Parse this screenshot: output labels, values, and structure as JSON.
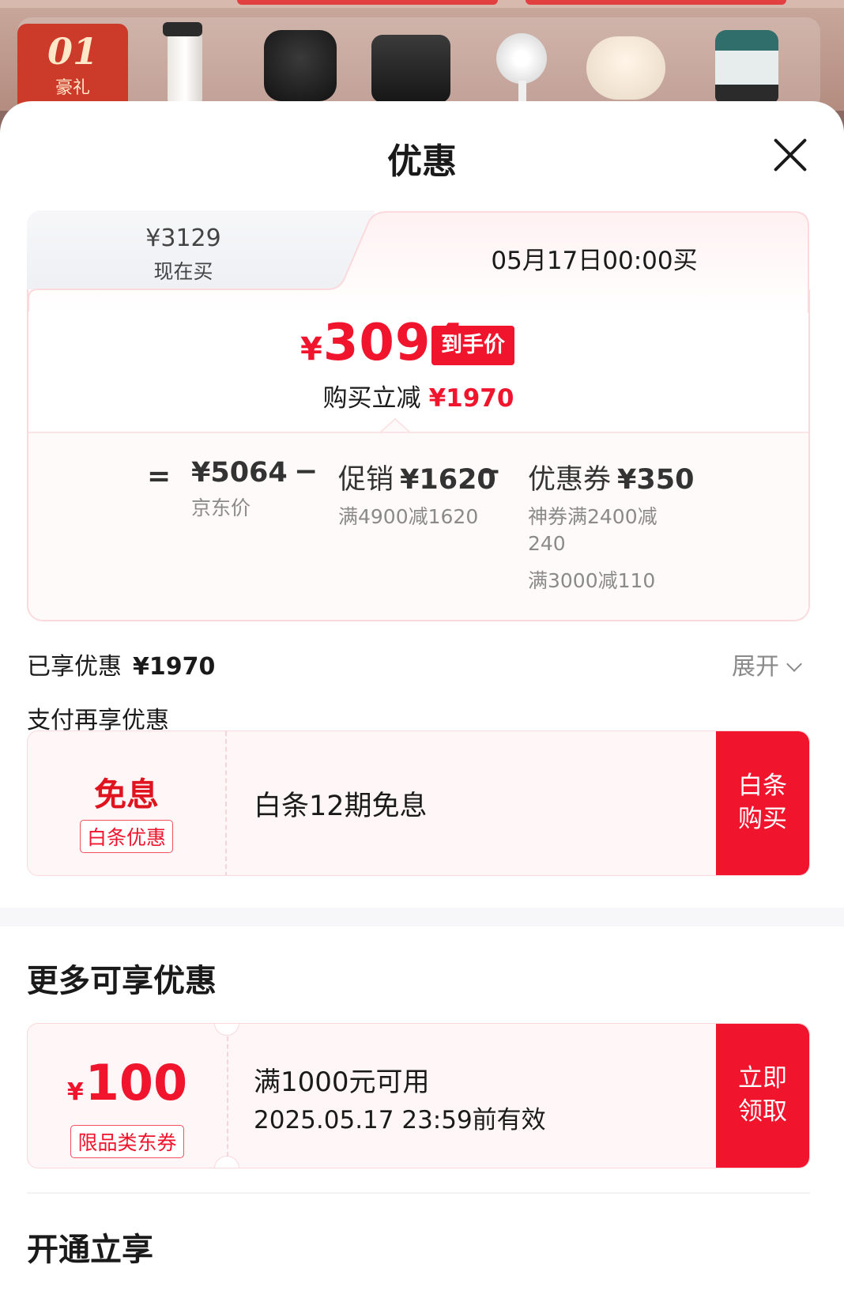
{
  "banner": {
    "badge_number": "01",
    "badge_label": "豪礼"
  },
  "sheet": {
    "title": "优惠"
  },
  "tabs": {
    "now": {
      "price": "¥3129",
      "label": "现在买"
    },
    "future": {
      "label": "05月17日00:00买"
    }
  },
  "deal": {
    "currency": "¥",
    "price": "3094",
    "price_tag": "到手价",
    "save_label": "购买立减",
    "save_amount": "¥1970"
  },
  "formula": {
    "equals": "=",
    "minus": "−",
    "jd_price": {
      "value": "¥5064",
      "label": "京东价"
    },
    "promotion": {
      "label": "促销",
      "value": "¥1620",
      "detail": "满4900减1620"
    },
    "coupon": {
      "label": "优惠券",
      "value": "¥350",
      "detail1": "神券满2400减240",
      "detail2": "满3000减110"
    }
  },
  "enjoyed": {
    "label": "已享优惠",
    "amount": "¥1970",
    "expand_label": "展开"
  },
  "pay_more_title": "支付再享优惠",
  "baitiao": {
    "headline": "免息",
    "tag": "白条优惠",
    "text": "白条12期免息",
    "button": "白条购买"
  },
  "more_title": "更多可享优惠",
  "coupon_100": {
    "currency": "¥",
    "amount": "100",
    "tag": "限品类东券",
    "condition": "满1000元可用",
    "validity": "2025.05.17 23:59前有效",
    "button": "立即领取"
  },
  "open_title": "开通立享",
  "colors": {
    "accent": "#f0152d",
    "border": "#fbd9dc"
  }
}
